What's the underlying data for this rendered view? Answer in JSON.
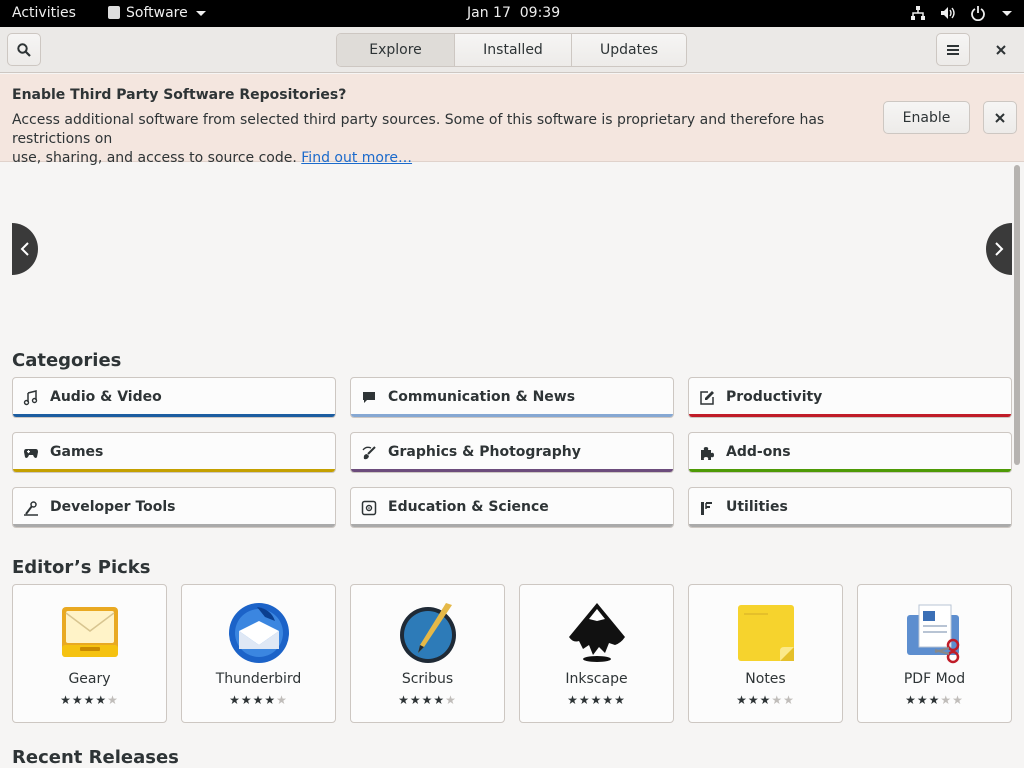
{
  "topbar": {
    "activities": "Activities",
    "app_name": "Software",
    "date": "Jan 17",
    "time": "09:39",
    "icons": [
      "network-icon",
      "volume-icon",
      "power-icon"
    ]
  },
  "header": {
    "tabs": [
      {
        "label": "Explore",
        "active": true
      },
      {
        "label": "Installed",
        "active": false
      },
      {
        "label": "Updates",
        "active": false
      }
    ]
  },
  "infobar": {
    "title": "Enable Third Party Software Repositories?",
    "text_line1": "Access additional software from selected third party sources. Some of this software is proprietary and therefore has restrictions on",
    "text_line2": "use, sharing, and access to source code.",
    "link": "Find out more…",
    "enable_label": "Enable"
  },
  "categories": {
    "title": "Categories",
    "items": [
      {
        "label": "Audio & Video",
        "icon": "music-note-icon",
        "color": "#1c5da0"
      },
      {
        "label": "Communication & News",
        "icon": "chat-bubble-icon",
        "color": "#86a8d3"
      },
      {
        "label": "Productivity",
        "icon": "edit-icon",
        "color": "#c01c28"
      },
      {
        "label": "Games",
        "icon": "gamepad-icon",
        "color": "#c4a000"
      },
      {
        "label": "Graphics & Photography",
        "icon": "brush-icon",
        "color": "#6c4c7c"
      },
      {
        "label": "Add-ons",
        "icon": "puzzle-icon",
        "color": "#4e9a06"
      },
      {
        "label": "Developer Tools",
        "icon": "tool-icon",
        "color": "#aaaaaa"
      },
      {
        "label": "Education & Science",
        "icon": "science-icon",
        "color": "#aaaaaa"
      },
      {
        "label": "Utilities",
        "icon": "utilities-icon",
        "color": "#aaaaaa"
      }
    ]
  },
  "editors_picks": {
    "title": "Editor’s Picks",
    "items": [
      {
        "name": "Geary",
        "rating": 4,
        "icon": "geary-app-icon"
      },
      {
        "name": "Thunderbird",
        "rating": 4,
        "icon": "thunderbird-app-icon"
      },
      {
        "name": "Scribus",
        "rating": 4,
        "icon": "scribus-app-icon"
      },
      {
        "name": "Inkscape",
        "rating": 5,
        "icon": "inkscape-app-icon"
      },
      {
        "name": "Notes",
        "rating": 3,
        "icon": "notes-app-icon"
      },
      {
        "name": "PDF Mod",
        "rating": 3,
        "icon": "pdfmod-app-icon"
      }
    ]
  },
  "recent": {
    "title": "Recent Releases"
  }
}
